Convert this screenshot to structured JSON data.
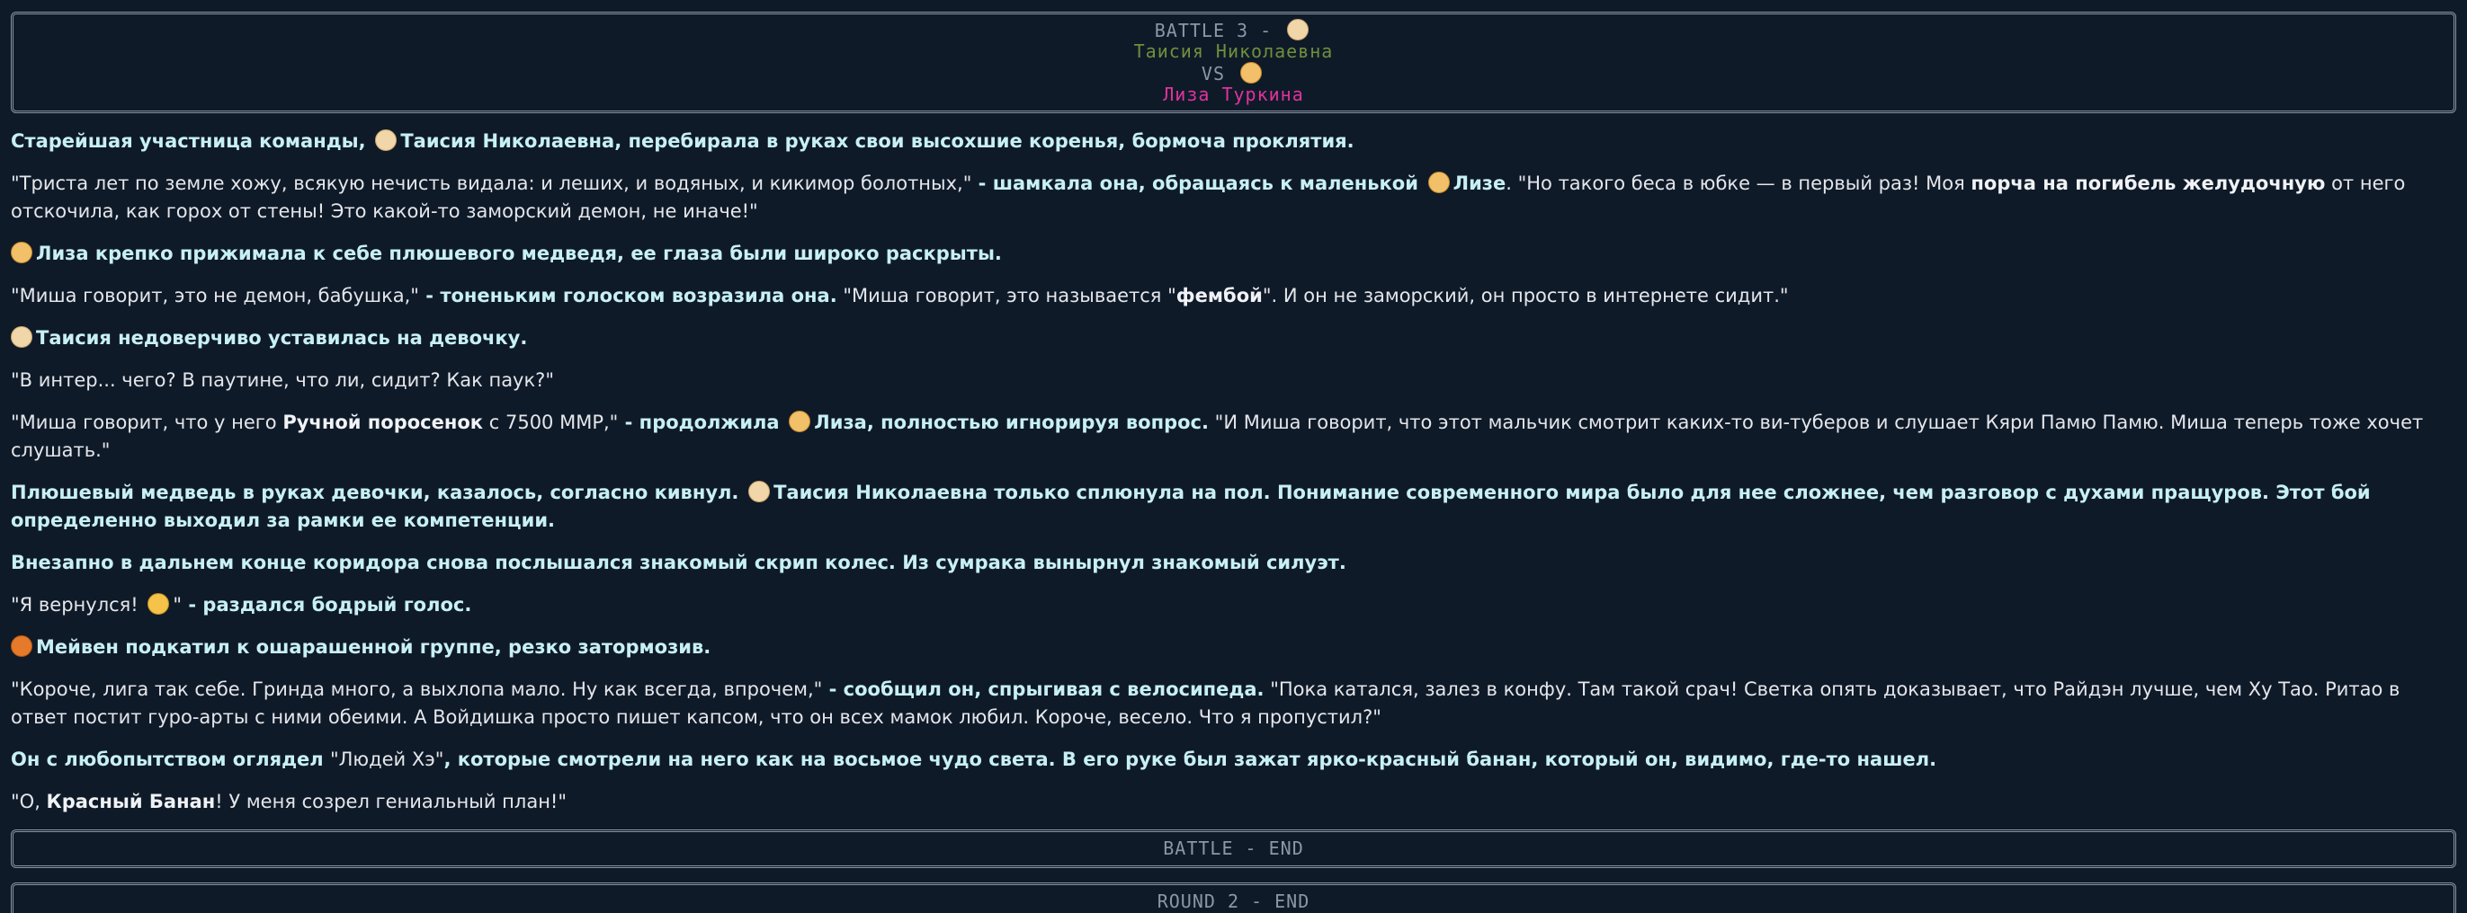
{
  "header": {
    "battle_line": "BATTLE 3 -",
    "fighter1": "Таисия Николаевна",
    "vs": "VS",
    "fighter2": "Лиза Туркина"
  },
  "text": {
    "p1_a": "Старейшая участница команды,",
    "p1_name": "Таисия Николаевна",
    "p1_b": ", перебирала в руках свои высохшие коренья, бормоча проклятия.",
    "p2_a": "\"Триста лет по земле хожу, всякую нечисть видала: и леших, и водяных, и кикимор болотных,\"",
    "p2_b": " - шамкала она, обращаясь к маленькой",
    "p2_name": "Лизе",
    "p2_c": ". \"Но такого беса в юбке — в первый раз! Моя ",
    "p2_bold": "порча на погибель желудочную",
    "p2_d": " от него отскочила, как горох от стены! Это какой-то заморский демон, не иначе!\"",
    "p3_name": "Лиза",
    "p3_a": " крепко прижимала к себе плюшевого медведя, ее глаза были широко раскрыты.",
    "p4_a": "\"Миша говорит, это не демон, бабушка,\"",
    "p4_b": " - тоненьким голоском возразила она.",
    "p4_c": " \"Миша говорит, это называется \"",
    "p4_bold": "фембой",
    "p4_d": "\". И он не заморский, он просто в интернете сидит.\"",
    "p5_name": "Таисия",
    "p5_a": " недоверчиво уставилась на девочку.",
    "p6_a": "\"В интер... чего? В паутине, что ли, сидит? Как паук?\"",
    "p7_a": "\"Миша говорит, что у него ",
    "p7_bold": "Ручной поросенок",
    "p7_b": " с 7500 ММР,\"",
    "p7_c": " - продолжила",
    "p7_name": "Лиза",
    "p7_d": ", полностью игнорируя вопрос.",
    "p7_e": " \"И Миша говорит, что этот мальчик смотрит каких-то ви-туберов и слушает Кяри Памю Памю. Миша теперь тоже хочет слушать.\"",
    "p8_a": "Плюшевый медведь в руках девочки, казалось, согласно кивнул.",
    "p8_name": "Таисия Николаевна",
    "p8_b": " только сплюнула на пол. Понимание современного мира было для нее сложнее, чем разговор с духами пращуров. Этот бой определенно выходил за рамки ее компетенции.",
    "p9_a": "Внезапно в дальнем конце коридора снова послышался знакомый скрип колес. Из сумрака вынырнул знакомый силуэт.",
    "p10_a": "\"Я вернулся!",
    "p10_b": "\"",
    "p10_c": " - раздался бодрый голос.",
    "p11_name": "Мейвен",
    "p11_a": " подкатил к ошарашенной группе, резко затормозив.",
    "p12_a": "\"Короче, лига так себе. Гринда много, а выхлопа мало. Ну как всегда, впрочем,\"",
    "p12_b": " - сообщил он, спрыгивая с велосипеда.",
    "p12_c": " \"Пока катался, залез в конфу. Там такой срач! Светка опять доказывает, что Райдэн лучше, чем Ху Тао. Ритао в ответ постит гуро-арты с ними обеими. А Войдишка просто пишет капсом, что он всех мамок любил. Короче, весело. Что я пропустил?\"",
    "p13_a": "Он с любопытством оглядел ",
    "p13_b": "\"Людей Хэ\"",
    "p13_c": ", которые смотрели на него как на восьмое чудо света. В его руке был зажат ярко-красный банан, который он, видимо, где-то нашел.",
    "p14_a": "\"О, ",
    "p14_bold": "Красный Банан",
    "p14_b": "! У меня созрел гениальный план!\""
  },
  "footer": {
    "battle_end": "BATTLE - END",
    "round_end": "ROUND 2 - END"
  },
  "icons": {
    "elder": "old-woman-emoji-icon",
    "girl": "girl-emoji-icon",
    "cat": "cat-emoji-icon",
    "fox": "fox-emoji-icon"
  },
  "colors": {
    "background": "#0f1a29",
    "name_green": "#6f8f3c",
    "name_pink": "#e0339b",
    "name_purple": "#9b4ee0",
    "action_text": "#c7f0f4"
  }
}
